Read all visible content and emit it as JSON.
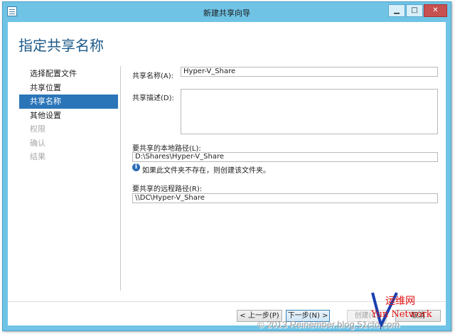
{
  "window": {
    "title": "新建共享向导"
  },
  "title_buttons": {
    "minimize": "▁",
    "maximize": "□",
    "close": "✕"
  },
  "page": {
    "title": "指定共享名称"
  },
  "nav": {
    "items": [
      {
        "label": "选择配置文件",
        "state": "normal"
      },
      {
        "label": "共享位置",
        "state": "normal"
      },
      {
        "label": "共享名称",
        "state": "selected"
      },
      {
        "label": "其他设置",
        "state": "normal"
      },
      {
        "label": "权限",
        "state": "disabled"
      },
      {
        "label": "确认",
        "state": "disabled"
      },
      {
        "label": "结果",
        "state": "disabled"
      }
    ]
  },
  "form": {
    "share_name": {
      "label": "共享名称(A):",
      "value": "Hyper-V_Share"
    },
    "share_description": {
      "label": "共享描述(D):",
      "value": ""
    },
    "local_path": {
      "label": "要共享的本地路径(L):",
      "value": "D:\\Shares\\Hyper-V_Share"
    },
    "info_text": "如果此文件夹不存在，则创建该文件夹。",
    "remote_path": {
      "label": "要共享的远程路径(R):",
      "value": "\\\\DC\\Hyper-V_Share"
    }
  },
  "buttons": {
    "prev": "< 上一步(P)",
    "next": "下一步(N) >",
    "create": "创建(C)",
    "cancel": "取消"
  },
  "logo": {
    "line1": "运维网",
    "line2": "Yun Network"
  },
  "watermark": "© 2013 Reinember.blog.51cto.com",
  "colors": {
    "title_bar": "#6fc4e6",
    "selected_nav": "#2a75b8",
    "page_title": "#1c5a8a",
    "info_icon": "#2a6db8",
    "logo_red": "#e01010",
    "logo_blue": "#1a3fb0"
  }
}
